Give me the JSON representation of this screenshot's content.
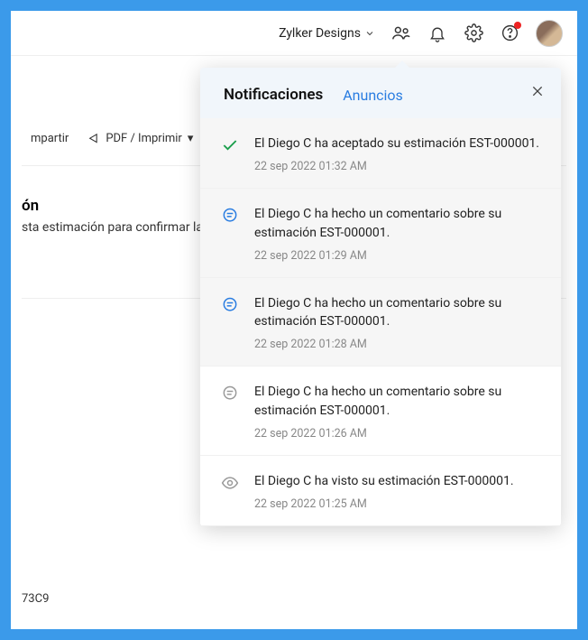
{
  "topbar": {
    "org_name": "Zylker Designs"
  },
  "toolbar": {
    "share_label": "mpartir",
    "pdf_label": "PDF / Imprimir"
  },
  "bg": {
    "heading_fragment": "ón",
    "body_fragment": "sta estimación para confirmar la ver",
    "footer_code": "73C9"
  },
  "notif_panel": {
    "tab_notifications": "Notificaciones",
    "tab_announcements": "Anuncios",
    "items": [
      {
        "icon": "check",
        "unread": true,
        "text": "El Diego C ha aceptado su estimación EST-000001.",
        "time": "22 sep 2022 01:32 AM"
      },
      {
        "icon": "comment",
        "unread": true,
        "text": "El Diego C ha hecho un comentario sobre su estimación EST-000001.",
        "time": "22 sep 2022 01:29 AM"
      },
      {
        "icon": "comment",
        "unread": true,
        "text": "El Diego C ha hecho un comentario sobre su estimación EST-000001.",
        "time": "22 sep 2022 01:28 AM"
      },
      {
        "icon": "comment-read",
        "unread": false,
        "text": "El Diego C ha hecho un comentario sobre su estimación EST-000001.",
        "time": "22 sep 2022 01:26 AM"
      },
      {
        "icon": "eye",
        "unread": false,
        "text": "El Diego C ha visto su estimación EST-000001.",
        "time": "22 sep 2022 01:25 AM"
      }
    ]
  }
}
